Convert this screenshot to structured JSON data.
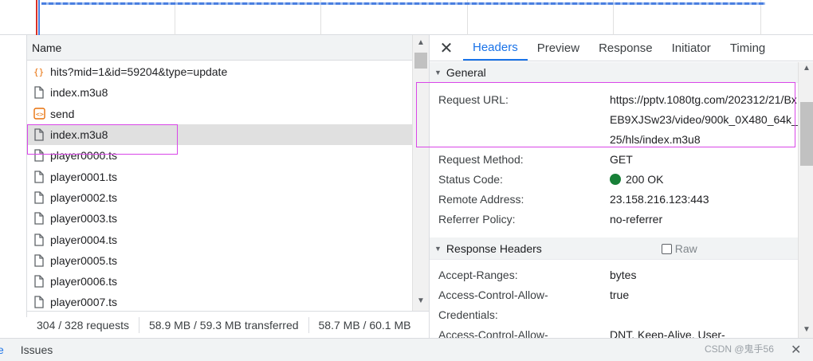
{
  "request_list": {
    "column_header": "Name",
    "rows": [
      {
        "name": "hits?mid=1&id=59204&type=update",
        "icon": "json-icon"
      },
      {
        "name": "index.m3u8",
        "icon": "file-icon"
      },
      {
        "name": "send",
        "icon": "script-icon"
      },
      {
        "name": "index.m3u8",
        "icon": "file-icon",
        "selected": true
      },
      {
        "name": "player0000.ts",
        "icon": "file-icon"
      },
      {
        "name": "player0001.ts",
        "icon": "file-icon"
      },
      {
        "name": "player0002.ts",
        "icon": "file-icon"
      },
      {
        "name": "player0003.ts",
        "icon": "file-icon"
      },
      {
        "name": "player0004.ts",
        "icon": "file-icon"
      },
      {
        "name": "player0005.ts",
        "icon": "file-icon"
      },
      {
        "name": "player0006.ts",
        "icon": "file-icon"
      },
      {
        "name": "player0007.ts",
        "icon": "file-icon"
      }
    ]
  },
  "status_bar": {
    "requests": "304 / 328 requests",
    "transferred": "58.9 MB / 59.3 MB transferred",
    "resources": "58.7 MB / 60.1 MB"
  },
  "details": {
    "close_label": "✕",
    "tabs": [
      "Headers",
      "Preview",
      "Response",
      "Initiator",
      "Timing"
    ],
    "active_tab": "Headers",
    "general": {
      "title": "General",
      "request_url_key": "Request URL:",
      "request_url": "https://pptv.1080tg.com/202312/21/BxEB9XJSw23/video/900k_0X480_64k_25/hls/index.m3u8",
      "method_key": "Request Method:",
      "method": "GET",
      "status_key": "Status Code:",
      "status": "200 OK",
      "remote_key": "Remote Address:",
      "remote": "23.158.216.123:443",
      "referrer_key": "Referrer Policy:",
      "referrer": "no-referrer"
    },
    "response_headers": {
      "title": "Response Headers",
      "raw_label": "Raw",
      "items": [
        {
          "k": "Accept-Ranges:",
          "v": "bytes"
        },
        {
          "k": "Access-Control-Allow-Credentials:",
          "v": "true"
        },
        {
          "k": "Access-Control-Allow-",
          "v": "DNT, Keep-Alive, User-"
        }
      ]
    }
  },
  "drawer": {
    "tab_console": "e",
    "tab_issues": "Issues",
    "watermark": "CSDN @鬼手56"
  },
  "colors": {
    "accent": "#1a73e8",
    "highlight": "#d946e8",
    "status_ok": "#188038"
  }
}
